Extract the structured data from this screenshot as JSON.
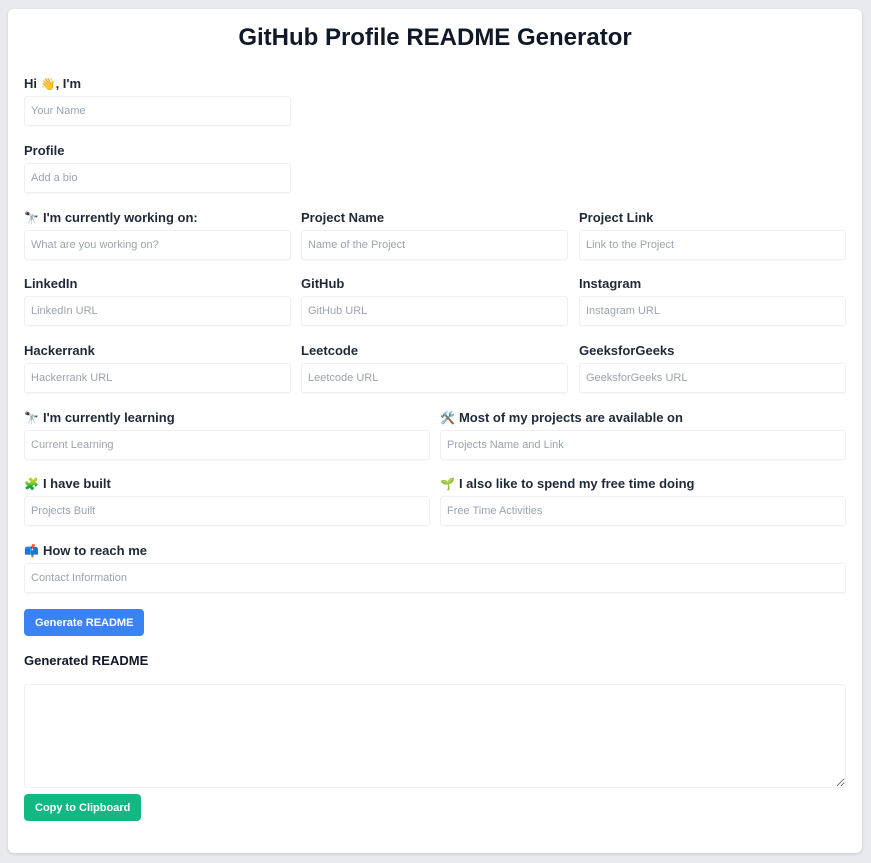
{
  "title": "GitHub Profile README Generator",
  "fields": {
    "name": {
      "label": "Hi",
      "emoji": "👋",
      "label_suffix": ", I'm",
      "placeholder": "Your Name",
      "value": ""
    },
    "bio": {
      "label": "Profile",
      "placeholder": "Add a bio",
      "value": ""
    },
    "working_on": {
      "emoji": "🔭",
      "label": "I'm currently working on:",
      "placeholder": "What are you working on?",
      "value": ""
    },
    "project_name": {
      "label": "Project Name",
      "placeholder": "Name of the Project",
      "value": ""
    },
    "project_link": {
      "label": "Project Link",
      "placeholder": "Link to the Project",
      "value": ""
    },
    "linkedin": {
      "label": "LinkedIn",
      "placeholder": "LinkedIn URL",
      "value": ""
    },
    "github": {
      "label": "GitHub",
      "placeholder": "GitHub URL",
      "value": ""
    },
    "instagram": {
      "label": "Instagram",
      "placeholder": "Instagram URL",
      "value": ""
    },
    "hackerrank": {
      "label": "Hackerrank",
      "placeholder": "Hackerrank URL",
      "value": ""
    },
    "leetcode": {
      "label": "Leetcode",
      "placeholder": "Leetcode URL",
      "value": ""
    },
    "geeksforgeeks": {
      "label": "GeeksforGeeks",
      "placeholder": "GeeksforGeeks URL",
      "value": ""
    },
    "learning": {
      "emoji": "🔭",
      "label": "I'm currently learning",
      "placeholder": "Current Learning",
      "value": ""
    },
    "projects_available": {
      "emoji": "🛠️",
      "label": "Most of my projects are available on",
      "placeholder": "Projects Name and Link",
      "value": ""
    },
    "built": {
      "emoji": "🧩",
      "label": "I have built",
      "placeholder": "Projects Built",
      "value": ""
    },
    "free_time": {
      "emoji": "🌱",
      "label": "I also like to spend my free time doing",
      "placeholder": "Free Time Activities",
      "value": ""
    },
    "contact": {
      "emoji": "📫",
      "label": "How to reach me",
      "placeholder": "Contact Information",
      "value": ""
    }
  },
  "buttons": {
    "generate": "Generate README",
    "copy": "Copy to Clipboard"
  },
  "output": {
    "title": "Generated README",
    "value": ""
  },
  "colors": {
    "primary": "#3b82f6",
    "success": "#10b981",
    "background": "#e9eaee"
  }
}
